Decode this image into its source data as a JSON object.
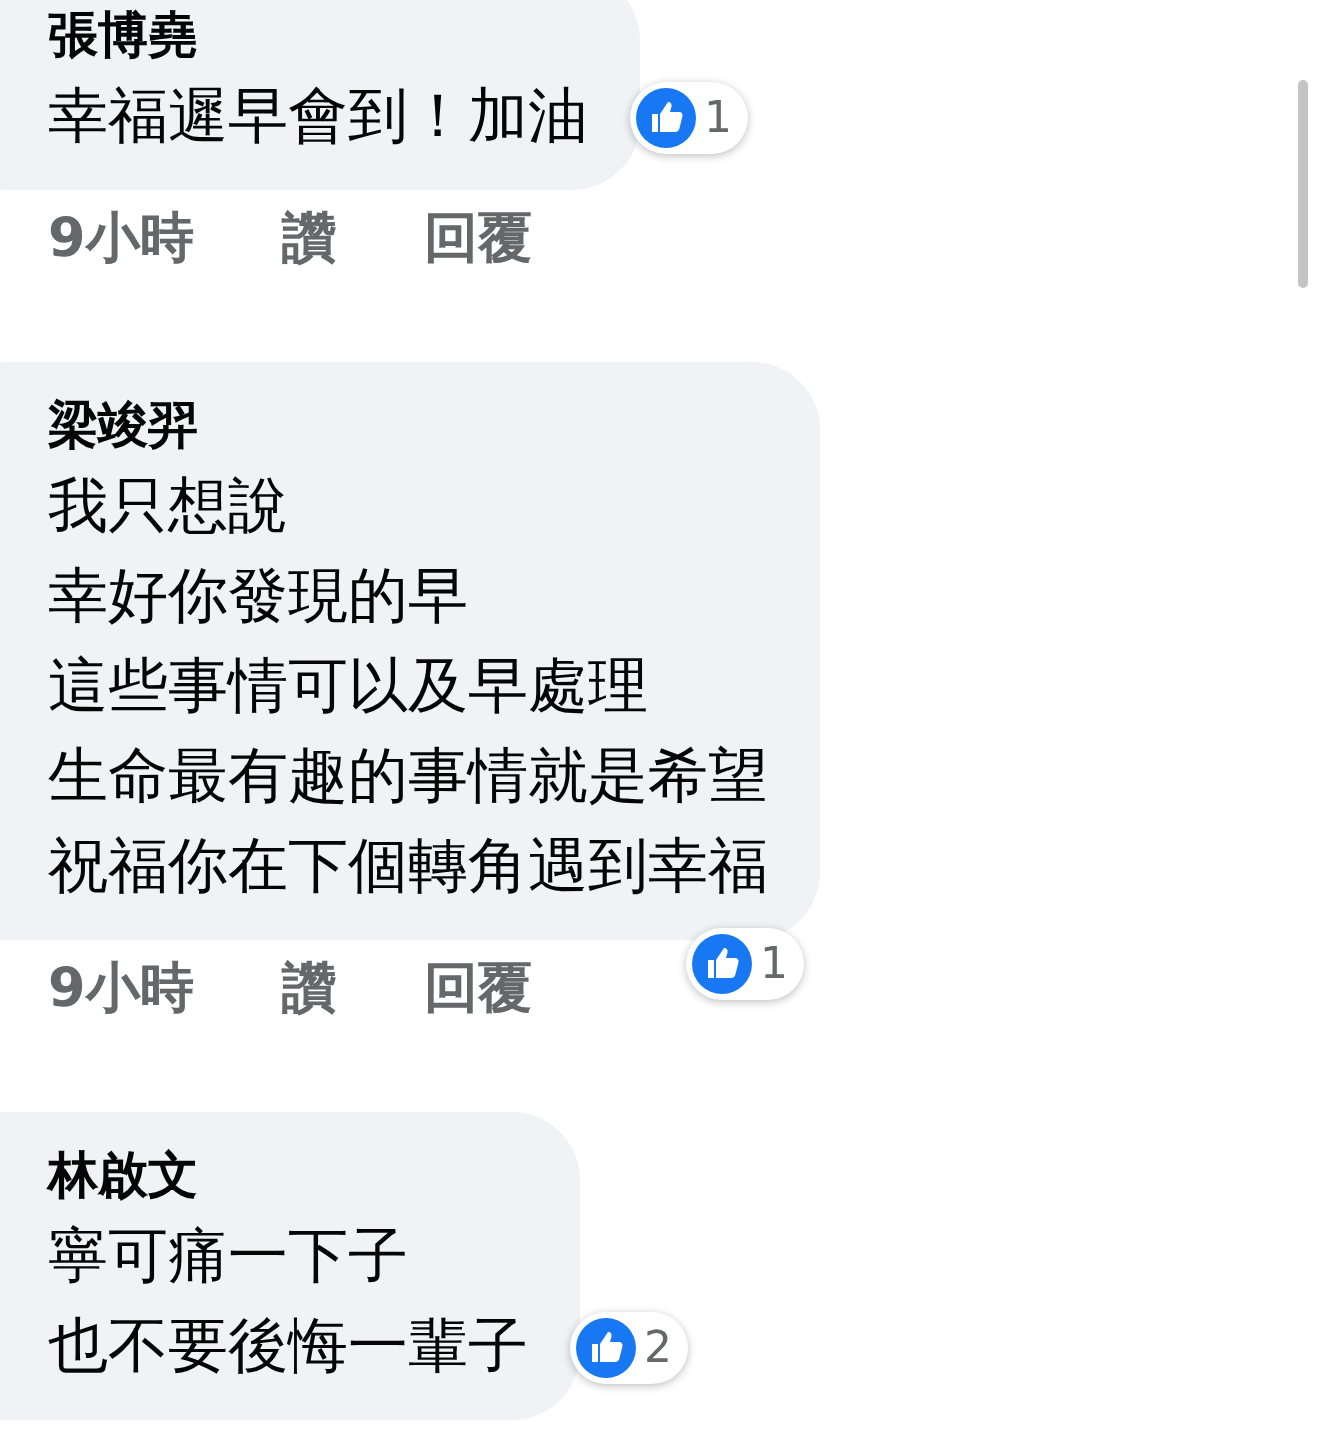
{
  "comments": [
    {
      "author": "張博堯",
      "lines": [
        "幸福遲早會到！加油"
      ],
      "reactions": "1",
      "time": "9小時",
      "actions": [
        "讚",
        "回覆"
      ]
    },
    {
      "author": "梁竣羿",
      "lines": [
        "我只想說",
        "幸好你發現的早",
        "這些事情可以及早處理",
        "生命最有趣的事情就是希望",
        "祝福你在下個轉角遇到幸福"
      ],
      "reactions": "1",
      "time": "9小時",
      "actions": [
        "讚",
        "回覆"
      ]
    },
    {
      "author": "林啟文",
      "lines": [
        "寧可痛一下子",
        "也不要後悔一輩子"
      ],
      "reactions": "2"
    }
  ]
}
